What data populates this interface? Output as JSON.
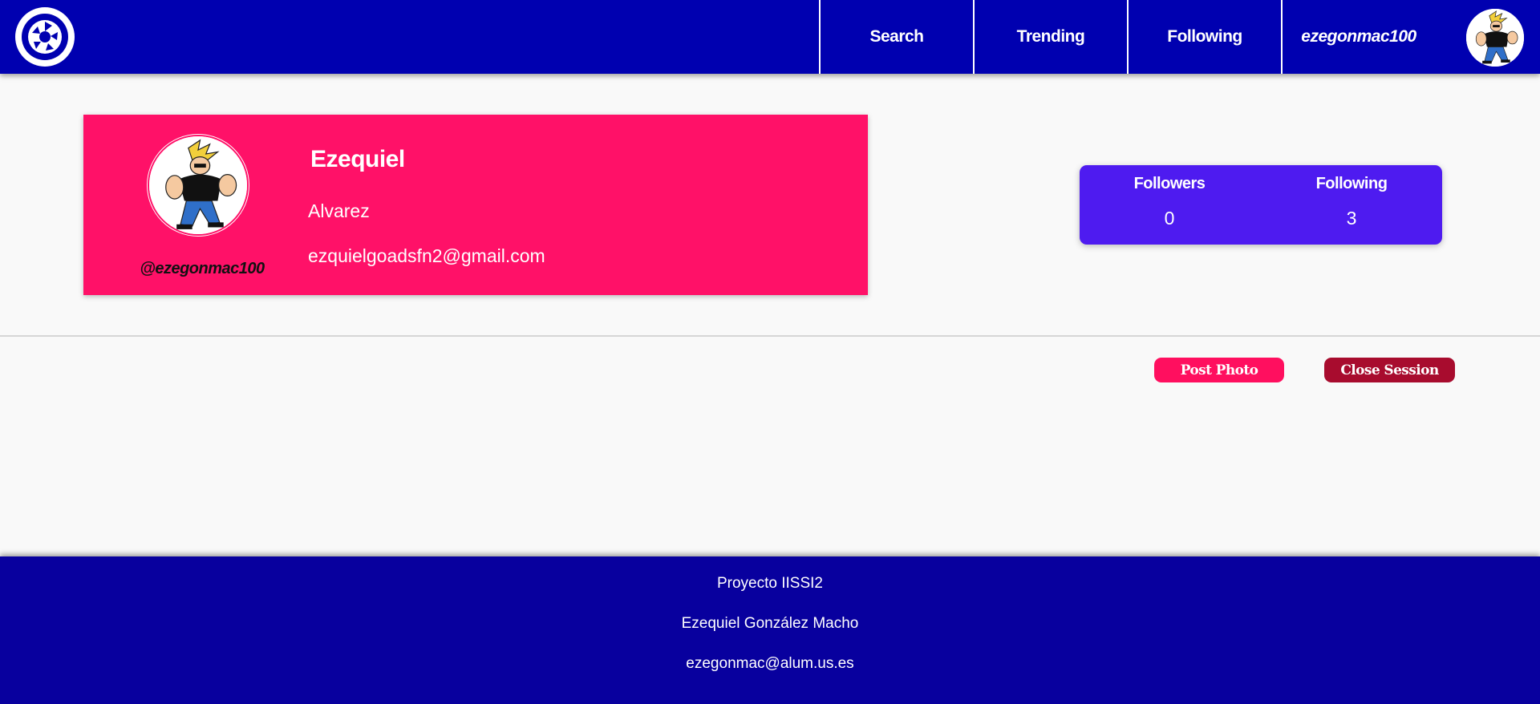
{
  "header": {
    "nav": {
      "search": "Search",
      "trending": "Trending",
      "following": "Following",
      "user": "ezegonmac100"
    }
  },
  "profile": {
    "first_name": "Ezequiel",
    "last_name": "Alvarez",
    "email": "ezquielgoadsfn2@gmail.com",
    "handle": "@ezegonmac100"
  },
  "stats": {
    "followers_label": "Followers",
    "followers_value": "0",
    "following_label": "Following",
    "following_value": "3"
  },
  "actions": {
    "post_photo": "Post Photo",
    "close_session": "Close Session"
  },
  "footer": {
    "line1": "Proyecto IISSI2",
    "line2": "Ezequiel González Macho",
    "line3": "ezegonmac@alum.us.es"
  },
  "colors": {
    "header_bg": "#0000b0",
    "profile_bg": "#ff1168",
    "stats_bg": "#4e1bf0",
    "post_button": "#ff0f5f",
    "close_button": "#a80c2e",
    "footer_bg": "#08009e"
  },
  "icons": {
    "logo": "camera-shutter-icon",
    "avatar": "cartoon-character-avatar"
  }
}
